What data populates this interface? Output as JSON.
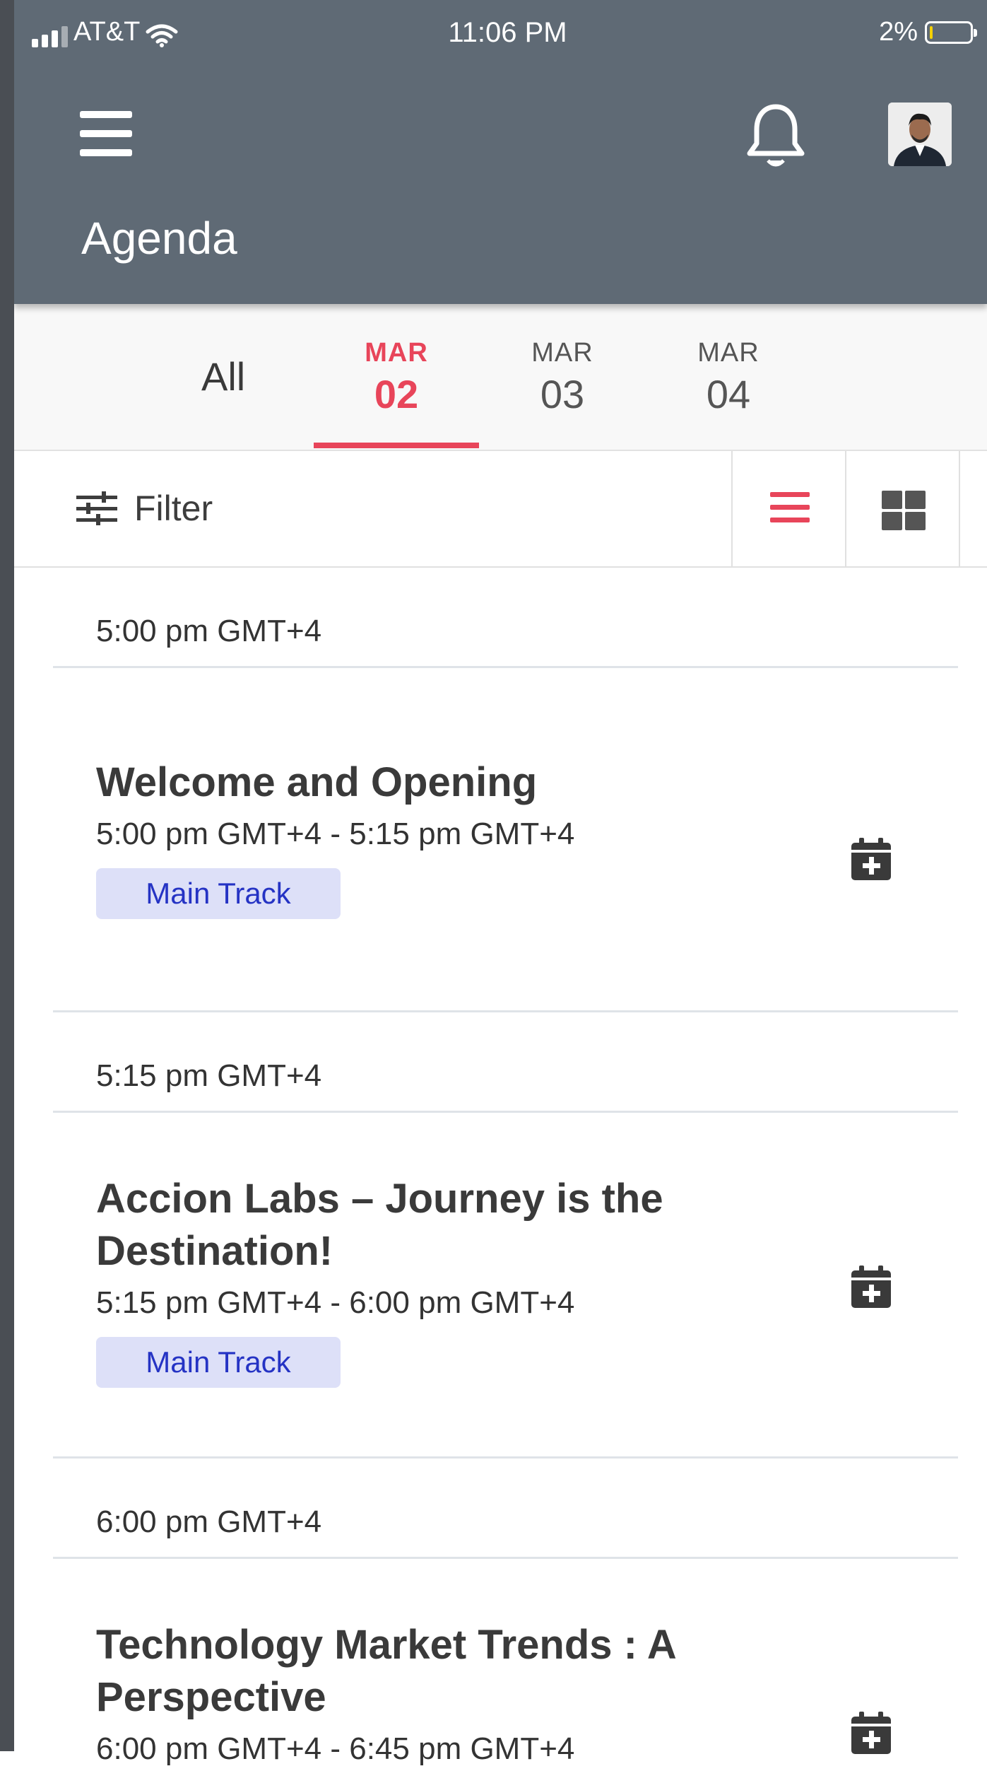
{
  "status_bar": {
    "carrier": "AT&T",
    "time": "11:06 PM",
    "battery": "2%",
    "signal_bars": 3
  },
  "header": {
    "title": "Agenda",
    "menu_icon": "hamburger-menu-icon",
    "notifications_icon": "bell-icon",
    "avatar": "user-avatar"
  },
  "date_tabs": {
    "all_label": "All",
    "dates": [
      {
        "month": "MAR",
        "day": "02",
        "active": true
      },
      {
        "month": "MAR",
        "day": "03",
        "active": false
      },
      {
        "month": "MAR",
        "day": "04",
        "active": false
      }
    ]
  },
  "toolbar": {
    "filter_label": "Filter",
    "list_view_icon": "list-view-icon",
    "grid_view_icon": "grid-view-icon",
    "active_view": "list"
  },
  "agenda": [
    {
      "time_header": "5:00 pm GMT+4",
      "session": {
        "title": "Welcome and Opening",
        "time": "5:00 pm GMT+4 - 5:15 pm GMT+4",
        "track": "Main Track"
      }
    },
    {
      "time_header": "5:15 pm GMT+4",
      "session": {
        "title": "Accion Labs – Journey is the Destination!",
        "time": "5:15 pm GMT+4 - 6:00 pm GMT+4",
        "track": "Main Track"
      }
    },
    {
      "time_header": "6:00 pm GMT+4",
      "session": {
        "title": "Technology Market Trends : A Perspective",
        "time": "6:00 pm GMT+4 - 6:45 pm GMT+4",
        "track": ""
      }
    }
  ],
  "colors": {
    "header_bg": "#5f6a75",
    "accent": "#e8455a",
    "tag_bg": "#dde0f8",
    "tag_text": "#2533c4"
  }
}
